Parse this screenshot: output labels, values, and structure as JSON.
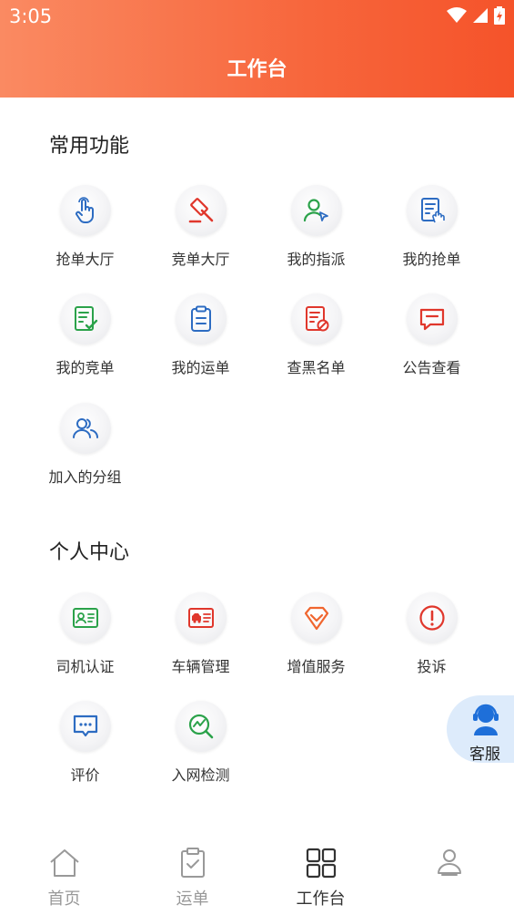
{
  "status": {
    "time": "3:05"
  },
  "header": {
    "title": "工作台"
  },
  "sections": {
    "common": {
      "title": "常用功能",
      "items": [
        {
          "label": "抢单大厅",
          "icon": "hand-tap-icon"
        },
        {
          "label": "竞单大厅",
          "icon": "auction-hammer-icon"
        },
        {
          "label": "我的指派",
          "icon": "user-assign-icon"
        },
        {
          "label": "我的抢单",
          "icon": "document-tap-icon"
        },
        {
          "label": "我的竞单",
          "icon": "document-check-icon"
        },
        {
          "label": "我的运单",
          "icon": "clipboard-icon"
        },
        {
          "label": "查黑名单",
          "icon": "blacklist-icon"
        },
        {
          "label": "公告查看",
          "icon": "message-icon"
        },
        {
          "label": "加入的分组",
          "icon": "group-icon"
        }
      ]
    },
    "personal": {
      "title": "个人中心",
      "items": [
        {
          "label": "司机认证",
          "icon": "id-card-icon"
        },
        {
          "label": "车辆管理",
          "icon": "vehicle-card-icon"
        },
        {
          "label": "增值服务",
          "icon": "diamond-icon"
        },
        {
          "label": "投诉",
          "icon": "alert-circle-icon"
        },
        {
          "label": "评价",
          "icon": "comment-icon"
        },
        {
          "label": "入网检测",
          "icon": "search-chart-icon"
        }
      ]
    }
  },
  "customer_service": {
    "label": "客服"
  },
  "bottom_nav": [
    {
      "label": "首页",
      "icon": "home-icon",
      "active": false
    },
    {
      "label": "运单",
      "icon": "waybill-icon",
      "active": false
    },
    {
      "label": "工作台",
      "icon": "workbench-icon",
      "active": true
    },
    {
      "label": "",
      "icon": "profile-icon",
      "active": false
    }
  ],
  "colors": {
    "header_start": "#fa8a62",
    "header_end": "#f5532a",
    "blue": "#2d6cc2",
    "red": "#e0372c",
    "green": "#2ba24a",
    "orange": "#f0662f"
  }
}
